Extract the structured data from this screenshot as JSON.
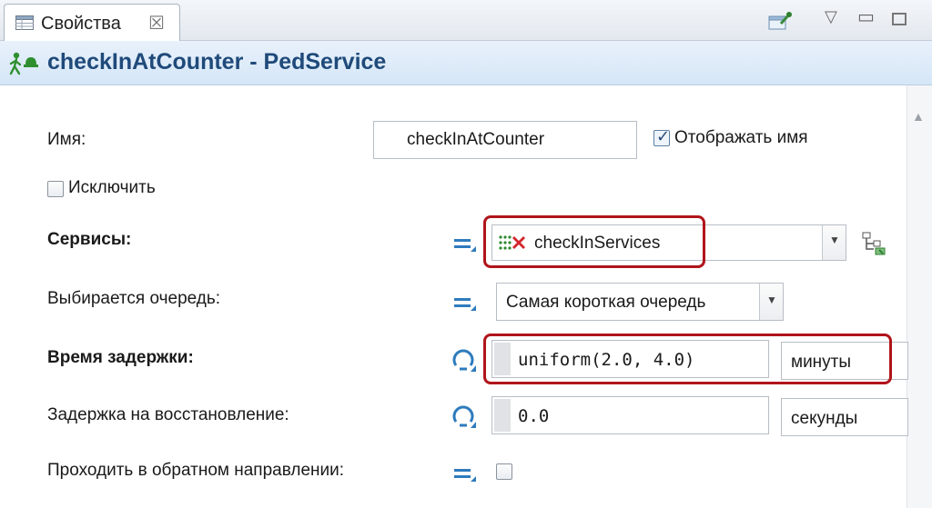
{
  "tab": {
    "label": "Свойства",
    "close": "☒"
  },
  "title": {
    "text": "checkInAtCounter - PedService"
  },
  "form": {
    "name": {
      "label": "Имя:",
      "value": "checkInAtCounter",
      "show_name_label": "Отображать имя",
      "show_name_checked": true
    },
    "exclude": {
      "label": "Исключить",
      "checked": false
    },
    "services": {
      "label": "Сервисы:",
      "value": "checkInServices"
    },
    "queue": {
      "label": "Выбирается очередь:",
      "value": "Самая короткая очередь"
    },
    "delay": {
      "label": "Время задержки:",
      "value": "uniform(2.0, 4.0)",
      "unit": "минуты"
    },
    "recovery": {
      "label": "Задержка на восстановление:",
      "value": "0.0",
      "unit": "секунды"
    },
    "reverse": {
      "label": "Проходить в обратном направлении:",
      "checked": false
    }
  },
  "icons": {
    "tab": "table-icon",
    "title": "pedestrian-service-icon",
    "equals": "static-value-icon",
    "dynamic": "dynamic-value-icon",
    "services": "services-icon",
    "select": "select-in-graph-icon"
  },
  "colors": {
    "highlight": "#b0151a",
    "title": "#1f4a7a",
    "accent": "#2e7bbd"
  }
}
